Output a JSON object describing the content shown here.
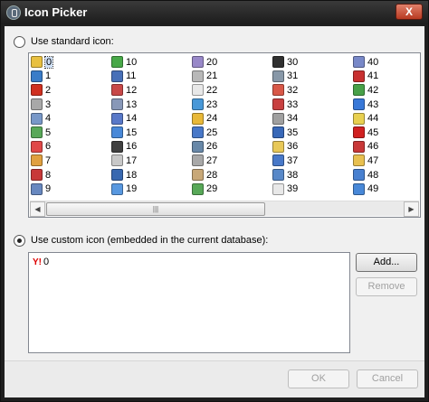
{
  "window": {
    "title": "Icon Picker",
    "close_label": "X"
  },
  "standard": {
    "label": "Use standard icon:",
    "selected": false
  },
  "icons": {
    "columns": [
      {
        "items": [
          {
            "n": "0",
            "c": "#e8c040"
          },
          {
            "n": "1",
            "c": "#3a7cc8"
          },
          {
            "n": "2",
            "c": "#d03020"
          },
          {
            "n": "3",
            "c": "#a8a8a8"
          },
          {
            "n": "4",
            "c": "#7898c8"
          },
          {
            "n": "5",
            "c": "#58a858"
          },
          {
            "n": "6",
            "c": "#e04848"
          },
          {
            "n": "7",
            "c": "#e0a040"
          },
          {
            "n": "8",
            "c": "#c83838"
          },
          {
            "n": "9",
            "c": "#6888c0"
          }
        ]
      },
      {
        "items": [
          {
            "n": "10",
            "c": "#48a848"
          },
          {
            "n": "11",
            "c": "#4870b8"
          },
          {
            "n": "12",
            "c": "#c84848"
          },
          {
            "n": "13",
            "c": "#8898b8"
          },
          {
            "n": "14",
            "c": "#5878c8"
          },
          {
            "n": "15",
            "c": "#4888d8"
          },
          {
            "n": "16",
            "c": "#404040"
          },
          {
            "n": "17",
            "c": "#c8c8c8"
          },
          {
            "n": "18",
            "c": "#3868b0"
          },
          {
            "n": "19",
            "c": "#5898e0"
          }
        ]
      },
      {
        "items": [
          {
            "n": "20",
            "c": "#9888c8"
          },
          {
            "n": "21",
            "c": "#b8b8b8"
          },
          {
            "n": "22",
            "c": "#e8e8e8"
          },
          {
            "n": "23",
            "c": "#4898d8"
          },
          {
            "n": "24",
            "c": "#e8b838"
          },
          {
            "n": "25",
            "c": "#4878c8"
          },
          {
            "n": "26",
            "c": "#6888a8"
          },
          {
            "n": "27",
            "c": "#a8a8a8"
          },
          {
            "n": "28",
            "c": "#c8a878"
          },
          {
            "n": "29",
            "c": "#58a858"
          }
        ]
      },
      {
        "items": [
          {
            "n": "30",
            "c": "#303030"
          },
          {
            "n": "31",
            "c": "#8898a8"
          },
          {
            "n": "32",
            "c": "#d85848"
          },
          {
            "n": "33",
            "c": "#c84040"
          },
          {
            "n": "34",
            "c": "#a0a0a0"
          },
          {
            "n": "35",
            "c": "#3868b8"
          },
          {
            "n": "36",
            "c": "#e8c858"
          },
          {
            "n": "37",
            "c": "#4878c8"
          },
          {
            "n": "38",
            "c": "#5888c8"
          },
          {
            "n": "39",
            "c": "#e8e8e8"
          }
        ]
      },
      {
        "items": [
          {
            "n": "40",
            "c": "#7888c8"
          },
          {
            "n": "41",
            "c": "#c83030"
          },
          {
            "n": "42",
            "c": "#48a048"
          },
          {
            "n": "43",
            "c": "#3878d8"
          },
          {
            "n": "44",
            "c": "#e8d050"
          },
          {
            "n": "45",
            "c": "#d02020"
          },
          {
            "n": "46",
            "c": "#c83838"
          },
          {
            "n": "47",
            "c": "#e8c050"
          },
          {
            "n": "48",
            "c": "#4880d0"
          },
          {
            "n": "49",
            "c": "#4888d8"
          }
        ]
      }
    ],
    "selected": "0"
  },
  "scrollbar": {
    "left_arrow": "◀",
    "right_arrow": "▶",
    "grip": "|||"
  },
  "custom": {
    "label": "Use custom icon (embedded in the current database):",
    "selected": true,
    "items": [
      {
        "glyph": "Y!",
        "label": "0"
      }
    ]
  },
  "buttons": {
    "add": "Add...",
    "remove": "Remove",
    "ok": "OK",
    "cancel": "Cancel"
  }
}
